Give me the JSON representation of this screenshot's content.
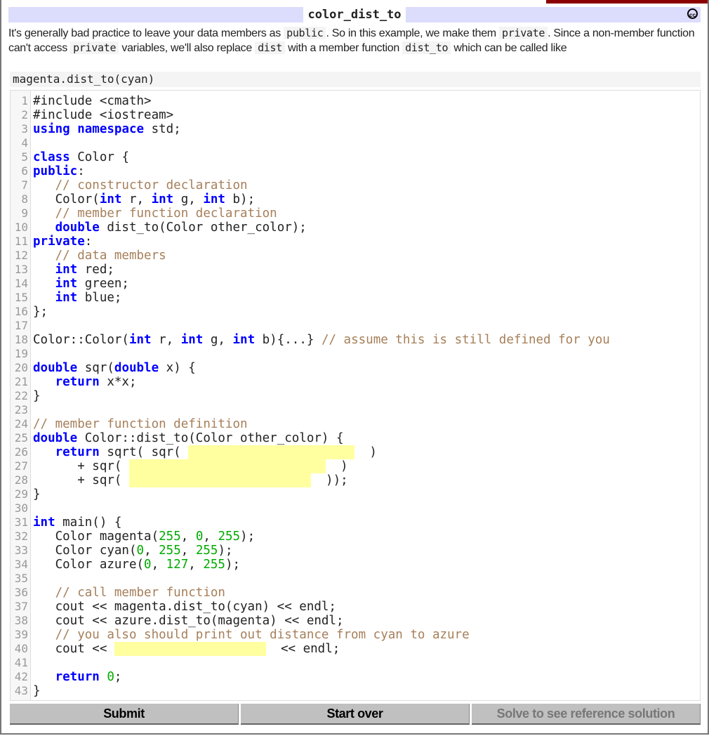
{
  "title": "color_dist_to",
  "license_icon": "creative-commons-icon",
  "license_label": "cc",
  "description": [
    {
      "t": "text",
      "v": "It's generally bad practice to leave your data members as "
    },
    {
      "t": "code",
      "v": "public"
    },
    {
      "t": "text",
      "v": ". So in this example, we make them "
    },
    {
      "t": "code",
      "v": "private"
    },
    {
      "t": "text",
      "v": ". Since a non-member function can't access "
    },
    {
      "t": "code",
      "v": "private"
    },
    {
      "t": "text",
      "v": " variables, we'll also replace "
    },
    {
      "t": "code",
      "v": "dist"
    },
    {
      "t": "text",
      "v": " with a member function "
    },
    {
      "t": "code",
      "v": "dist_to"
    },
    {
      "t": "text",
      "v": " which can be called like"
    }
  ],
  "example": "magenta.dist_to(cyan)",
  "colors": {
    "keyword": "#0000ff",
    "comment": "#a67f59",
    "number": "#00aa00",
    "blank": "#ffffa0",
    "titlebar": "#dcdcfc"
  },
  "code": [
    [
      [
        "t",
        "#include <cmath>"
      ]
    ],
    [
      [
        "t",
        "#include <iostream>"
      ]
    ],
    [
      [
        "k",
        "using"
      ],
      [
        "t",
        " "
      ],
      [
        "k",
        "namespace"
      ],
      [
        "t",
        " std;"
      ]
    ],
    [],
    [
      [
        "k",
        "class"
      ],
      [
        "t",
        " Color {"
      ]
    ],
    [
      [
        "k",
        "public"
      ],
      [
        "t",
        ":"
      ]
    ],
    [
      [
        "t",
        "   "
      ],
      [
        "c",
        "// constructor declaration"
      ]
    ],
    [
      [
        "t",
        "   Color("
      ],
      [
        "k",
        "int"
      ],
      [
        "t",
        " r, "
      ],
      [
        "k",
        "int"
      ],
      [
        "t",
        " g, "
      ],
      [
        "k",
        "int"
      ],
      [
        "t",
        " b);"
      ]
    ],
    [
      [
        "t",
        "   "
      ],
      [
        "c",
        "// member function declaration"
      ]
    ],
    [
      [
        "t",
        "   "
      ],
      [
        "k",
        "double"
      ],
      [
        "t",
        " dist_to(Color other_color);"
      ]
    ],
    [
      [
        "k",
        "private"
      ],
      [
        "t",
        ":"
      ]
    ],
    [
      [
        "t",
        "   "
      ],
      [
        "c",
        "// data members"
      ]
    ],
    [
      [
        "t",
        "   "
      ],
      [
        "k",
        "int"
      ],
      [
        "t",
        " red;"
      ]
    ],
    [
      [
        "t",
        "   "
      ],
      [
        "k",
        "int"
      ],
      [
        "t",
        " green;"
      ]
    ],
    [
      [
        "t",
        "   "
      ],
      [
        "k",
        "int"
      ],
      [
        "t",
        " blue;"
      ]
    ],
    [
      [
        "t",
        "};"
      ]
    ],
    [],
    [
      [
        "t",
        "Color::Color("
      ],
      [
        "k",
        "int"
      ],
      [
        "t",
        " r, "
      ],
      [
        "k",
        "int"
      ],
      [
        "t",
        " g, "
      ],
      [
        "k",
        "int"
      ],
      [
        "t",
        " b){...} "
      ],
      [
        "c",
        "// assume this is still defined for you"
      ]
    ],
    [],
    [
      [
        "k",
        "double"
      ],
      [
        "t",
        " sqr("
      ],
      [
        "k",
        "double"
      ],
      [
        "t",
        " x) {"
      ]
    ],
    [
      [
        "t",
        "   "
      ],
      [
        "k",
        "return"
      ],
      [
        "t",
        " x*x;"
      ]
    ],
    [
      [
        "t",
        "}"
      ]
    ],
    [],
    [
      [
        "c",
        "// member function definition"
      ]
    ],
    [
      [
        "k",
        "double"
      ],
      [
        "t",
        " Color::dist_to(Color other_color) {"
      ]
    ],
    [
      [
        "t",
        "   "
      ],
      [
        "k",
        "return"
      ],
      [
        "t",
        " sqrt( sqr( "
      ],
      [
        "b",
        ""
      ],
      [
        "t",
        "  )"
      ]
    ],
    [
      [
        "t",
        "      + sqr( "
      ],
      [
        "b",
        ""
      ],
      [
        "t",
        "  )"
      ]
    ],
    [
      [
        "t",
        "      + sqr( "
      ],
      [
        "b",
        ""
      ],
      [
        "t",
        "  ));"
      ]
    ],
    [
      [
        "t",
        "}"
      ]
    ],
    [],
    [
      [
        "k",
        "int"
      ],
      [
        "t",
        " main() {"
      ]
    ],
    [
      [
        "t",
        "   Color magenta("
      ],
      [
        "n",
        "255"
      ],
      [
        "t",
        ", "
      ],
      [
        "n",
        "0"
      ],
      [
        "t",
        ", "
      ],
      [
        "n",
        "255"
      ],
      [
        "t",
        ");"
      ]
    ],
    [
      [
        "t",
        "   Color cyan("
      ],
      [
        "n",
        "0"
      ],
      [
        "t",
        ", "
      ],
      [
        "n",
        "255"
      ],
      [
        "t",
        ", "
      ],
      [
        "n",
        "255"
      ],
      [
        "t",
        ");"
      ]
    ],
    [
      [
        "t",
        "   Color azure("
      ],
      [
        "n",
        "0"
      ],
      [
        "t",
        ", "
      ],
      [
        "n",
        "127"
      ],
      [
        "t",
        ", "
      ],
      [
        "n",
        "255"
      ],
      [
        "t",
        ");"
      ]
    ],
    [],
    [
      [
        "t",
        "   "
      ],
      [
        "c",
        "// call member function"
      ]
    ],
    [
      [
        "t",
        "   cout << magenta.dist_to(cyan) << endl;"
      ]
    ],
    [
      [
        "t",
        "   cout << azure.dist_to(magenta) << endl;"
      ]
    ],
    [
      [
        "t",
        "   "
      ],
      [
        "c",
        "// you also should print out distance from cyan to azure"
      ]
    ],
    [
      [
        "t",
        "   cout << "
      ],
      [
        "b",
        ""
      ],
      [
        "t",
        "  << endl;"
      ]
    ],
    [],
    [
      [
        "t",
        "   "
      ],
      [
        "k",
        "return"
      ],
      [
        "t",
        " "
      ],
      [
        "n",
        "0"
      ],
      [
        "t",
        ";"
      ]
    ],
    [
      [
        "t",
        "}"
      ]
    ]
  ],
  "buttons": {
    "submit": "Submit",
    "start_over": "Start over",
    "solve": "Solve to see reference solution"
  }
}
